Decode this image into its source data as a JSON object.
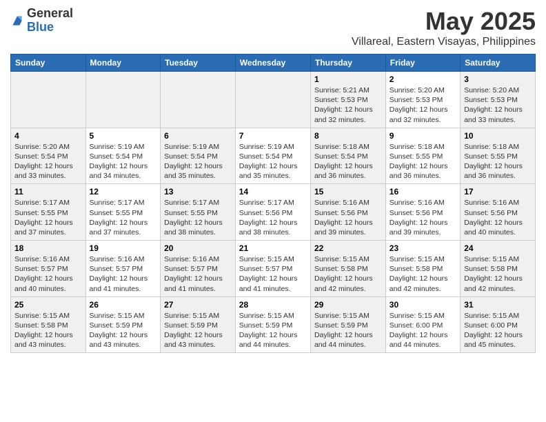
{
  "logo": {
    "general": "General",
    "blue": "Blue"
  },
  "title": "May 2025",
  "location": "Villareal, Eastern Visayas, Philippines",
  "days_of_week": [
    "Sunday",
    "Monday",
    "Tuesday",
    "Wednesday",
    "Thursday",
    "Friday",
    "Saturday"
  ],
  "weeks": [
    [
      {
        "num": "",
        "info": ""
      },
      {
        "num": "",
        "info": ""
      },
      {
        "num": "",
        "info": ""
      },
      {
        "num": "",
        "info": ""
      },
      {
        "num": "1",
        "info": "Sunrise: 5:21 AM\nSunset: 5:53 PM\nDaylight: 12 hours\nand 32 minutes."
      },
      {
        "num": "2",
        "info": "Sunrise: 5:20 AM\nSunset: 5:53 PM\nDaylight: 12 hours\nand 32 minutes."
      },
      {
        "num": "3",
        "info": "Sunrise: 5:20 AM\nSunset: 5:53 PM\nDaylight: 12 hours\nand 33 minutes."
      }
    ],
    [
      {
        "num": "4",
        "info": "Sunrise: 5:20 AM\nSunset: 5:54 PM\nDaylight: 12 hours\nand 33 minutes."
      },
      {
        "num": "5",
        "info": "Sunrise: 5:19 AM\nSunset: 5:54 PM\nDaylight: 12 hours\nand 34 minutes."
      },
      {
        "num": "6",
        "info": "Sunrise: 5:19 AM\nSunset: 5:54 PM\nDaylight: 12 hours\nand 35 minutes."
      },
      {
        "num": "7",
        "info": "Sunrise: 5:19 AM\nSunset: 5:54 PM\nDaylight: 12 hours\nand 35 minutes."
      },
      {
        "num": "8",
        "info": "Sunrise: 5:18 AM\nSunset: 5:54 PM\nDaylight: 12 hours\nand 36 minutes."
      },
      {
        "num": "9",
        "info": "Sunrise: 5:18 AM\nSunset: 5:55 PM\nDaylight: 12 hours\nand 36 minutes."
      },
      {
        "num": "10",
        "info": "Sunrise: 5:18 AM\nSunset: 5:55 PM\nDaylight: 12 hours\nand 36 minutes."
      }
    ],
    [
      {
        "num": "11",
        "info": "Sunrise: 5:17 AM\nSunset: 5:55 PM\nDaylight: 12 hours\nand 37 minutes."
      },
      {
        "num": "12",
        "info": "Sunrise: 5:17 AM\nSunset: 5:55 PM\nDaylight: 12 hours\nand 37 minutes."
      },
      {
        "num": "13",
        "info": "Sunrise: 5:17 AM\nSunset: 5:55 PM\nDaylight: 12 hours\nand 38 minutes."
      },
      {
        "num": "14",
        "info": "Sunrise: 5:17 AM\nSunset: 5:56 PM\nDaylight: 12 hours\nand 38 minutes."
      },
      {
        "num": "15",
        "info": "Sunrise: 5:16 AM\nSunset: 5:56 PM\nDaylight: 12 hours\nand 39 minutes."
      },
      {
        "num": "16",
        "info": "Sunrise: 5:16 AM\nSunset: 5:56 PM\nDaylight: 12 hours\nand 39 minutes."
      },
      {
        "num": "17",
        "info": "Sunrise: 5:16 AM\nSunset: 5:56 PM\nDaylight: 12 hours\nand 40 minutes."
      }
    ],
    [
      {
        "num": "18",
        "info": "Sunrise: 5:16 AM\nSunset: 5:57 PM\nDaylight: 12 hours\nand 40 minutes."
      },
      {
        "num": "19",
        "info": "Sunrise: 5:16 AM\nSunset: 5:57 PM\nDaylight: 12 hours\nand 41 minutes."
      },
      {
        "num": "20",
        "info": "Sunrise: 5:16 AM\nSunset: 5:57 PM\nDaylight: 12 hours\nand 41 minutes."
      },
      {
        "num": "21",
        "info": "Sunrise: 5:15 AM\nSunset: 5:57 PM\nDaylight: 12 hours\nand 41 minutes."
      },
      {
        "num": "22",
        "info": "Sunrise: 5:15 AM\nSunset: 5:58 PM\nDaylight: 12 hours\nand 42 minutes."
      },
      {
        "num": "23",
        "info": "Sunrise: 5:15 AM\nSunset: 5:58 PM\nDaylight: 12 hours\nand 42 minutes."
      },
      {
        "num": "24",
        "info": "Sunrise: 5:15 AM\nSunset: 5:58 PM\nDaylight: 12 hours\nand 42 minutes."
      }
    ],
    [
      {
        "num": "25",
        "info": "Sunrise: 5:15 AM\nSunset: 5:58 PM\nDaylight: 12 hours\nand 43 minutes."
      },
      {
        "num": "26",
        "info": "Sunrise: 5:15 AM\nSunset: 5:59 PM\nDaylight: 12 hours\nand 43 minutes."
      },
      {
        "num": "27",
        "info": "Sunrise: 5:15 AM\nSunset: 5:59 PM\nDaylight: 12 hours\nand 43 minutes."
      },
      {
        "num": "28",
        "info": "Sunrise: 5:15 AM\nSunset: 5:59 PM\nDaylight: 12 hours\nand 44 minutes."
      },
      {
        "num": "29",
        "info": "Sunrise: 5:15 AM\nSunset: 5:59 PM\nDaylight: 12 hours\nand 44 minutes."
      },
      {
        "num": "30",
        "info": "Sunrise: 5:15 AM\nSunset: 6:00 PM\nDaylight: 12 hours\nand 44 minutes."
      },
      {
        "num": "31",
        "info": "Sunrise: 5:15 AM\nSunset: 6:00 PM\nDaylight: 12 hours\nand 45 minutes."
      }
    ]
  ]
}
